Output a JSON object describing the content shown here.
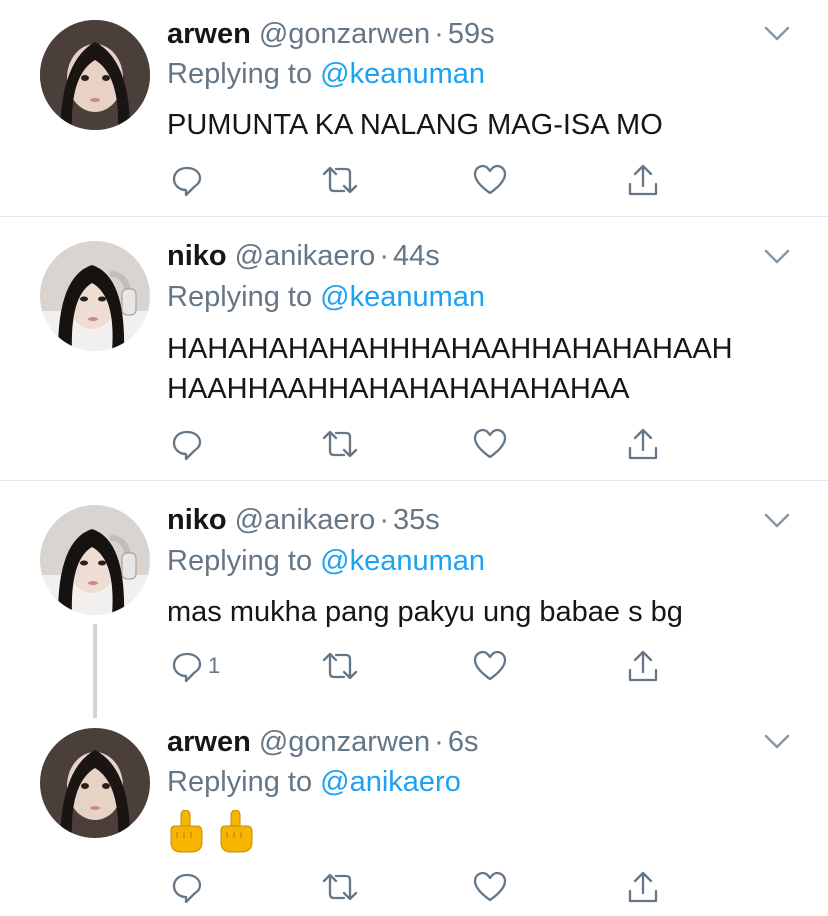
{
  "tweets": [
    {
      "name": "arwen",
      "handle": "@gonzarwen",
      "dot": "·",
      "time": "59s",
      "reply_prefix": "Replying to",
      "reply_to": "@keanuman",
      "text": "PUMUNTA KA NALANG MAG-ISA MO",
      "reply_count": ""
    },
    {
      "name": "niko",
      "handle": "@anikaero",
      "dot": "·",
      "time": "44s",
      "reply_prefix": "Replying to",
      "reply_to": "@keanuman",
      "text": "HAHAHAHAHAHHHAHAAHHAHAHAHAAH\nHAAHHAAHHAHAHAHAHAHAHAA",
      "reply_count": ""
    },
    {
      "name": "niko",
      "handle": "@anikaero",
      "dot": "·",
      "time": "35s",
      "reply_prefix": "Replying to",
      "reply_to": "@keanuman",
      "text": "mas mukha pang pakyu ung babae s bg",
      "reply_count": "1"
    },
    {
      "name": "arwen",
      "handle": "@gonzarwen",
      "dot": "·",
      "time": "6s",
      "reply_prefix": "Replying to",
      "reply_to": "@anikaero",
      "text": "",
      "emoji": "middle-finger-emoji x2",
      "reply_count": ""
    }
  ],
  "colors": {
    "name": "#14171a",
    "secondary": "#657786",
    "mention": "#1da1f2",
    "separator": "#e1e8ed",
    "thread_line": "#ccd6dd",
    "icon": "#657786"
  },
  "icons": [
    "chevron-down-icon",
    "reply-icon",
    "retweet-icon",
    "like-icon",
    "share-icon"
  ]
}
